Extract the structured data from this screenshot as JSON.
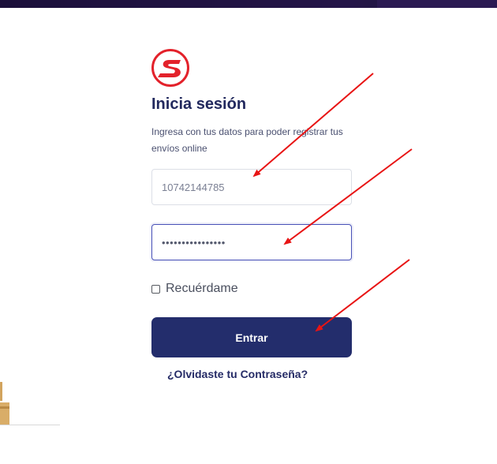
{
  "colors": {
    "brand_red": "#e3222b",
    "navy": "#232d6c",
    "arrow": "#e81414"
  },
  "logo": {
    "icon": "red-s-logo"
  },
  "login": {
    "title": "Inicia sesión",
    "subtitle": "Ingresa con tus datos para poder registrar tus envíos online",
    "user_value": "10742144785",
    "password_value": "••••••••••••••••",
    "remember_label": "Recuérdame",
    "remember_checked": false,
    "submit_label": "Entrar",
    "forgot_label": "¿Olvidaste tu Contraseña?"
  }
}
